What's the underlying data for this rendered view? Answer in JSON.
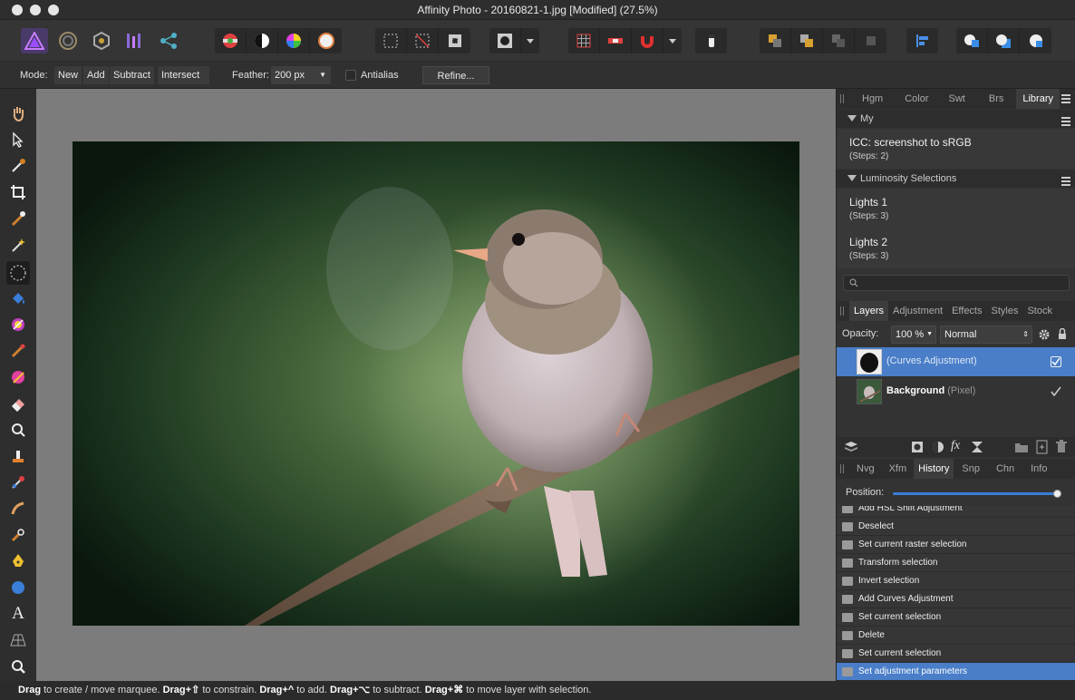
{
  "window": {
    "title": "Affinity Photo - 20160821-1.jpg [Modified] (27.5%)"
  },
  "context": {
    "mode_label": "Mode:",
    "modes": [
      "New",
      "Add",
      "Subtract",
      "Intersect"
    ],
    "feather_label": "Feather:",
    "feather_value": "200 px",
    "antialias_label": "Antialias",
    "refine_label": "Refine..."
  },
  "library": {
    "tabs": [
      "Hgm",
      "Color",
      "Swt",
      "Brs",
      "Library"
    ],
    "active_tab": "Library",
    "groups": [
      {
        "name": "My",
        "macros": [
          {
            "title": "ICC: screenshot to sRGB",
            "steps": "(Steps: 2)"
          }
        ]
      },
      {
        "name": "Luminosity Selections",
        "macros": [
          {
            "title": "Lights 1",
            "steps": "(Steps: 3)"
          },
          {
            "title": "Lights 2",
            "steps": "(Steps: 3)"
          }
        ]
      }
    ]
  },
  "layers": {
    "tabs": [
      "Layers",
      "Adjustment",
      "Effects",
      "Styles",
      "Stock"
    ],
    "active_tab": "Layers",
    "opacity_label": "Opacity:",
    "opacity_value": "100 %",
    "blend_mode": "Normal",
    "items": [
      {
        "name": "(Curves Adjustment)",
        "type": "",
        "selected": true
      },
      {
        "name": "Background",
        "type": "(Pixel)",
        "selected": false
      }
    ]
  },
  "history": {
    "tabs": [
      "Nvg",
      "Xfm",
      "History",
      "Snp",
      "Chn",
      "Info"
    ],
    "active_tab": "History",
    "position_label": "Position:",
    "position": 0.98,
    "items": [
      "Add HSL Shift Adjustment",
      "Deselect",
      "Set current raster selection",
      "Transform selection",
      "Invert selection",
      "Add Curves Adjustment",
      "Set current selection",
      "Delete",
      "Set current selection",
      "Set adjustment parameters"
    ],
    "selected_index": 9
  },
  "status": {
    "parts": [
      {
        "b": "Drag",
        "t": " to create / move marquee. "
      },
      {
        "b": "Drag+⇧",
        "t": " to constrain. "
      },
      {
        "b": "Drag+^",
        "t": " to add. "
      },
      {
        "b": "Drag+⌥",
        "t": " to subtract. "
      },
      {
        "b": "Drag+⌘",
        "t": " to move layer with selection."
      }
    ]
  },
  "colors": {
    "accent": "#4a7ec8",
    "background": "#333333",
    "canvas": "#7c7c7c"
  }
}
